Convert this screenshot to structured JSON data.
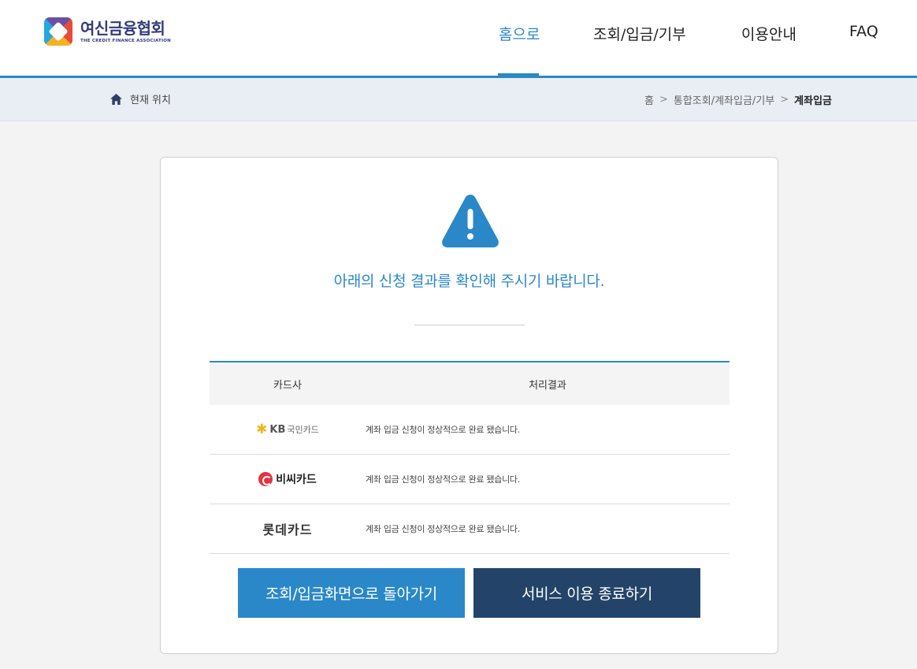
{
  "header": {
    "logo_kr": "여신금융협회",
    "logo_en": "THE CREDIT FINANCE ASSOCIATION",
    "nav": [
      {
        "label": "홈으로",
        "active": true
      },
      {
        "label": "조회/입금/기부",
        "active": false
      },
      {
        "label": "이용안내",
        "active": false
      },
      {
        "label": "FAQ",
        "active": false
      }
    ]
  },
  "breadcrumb": {
    "location_label": "현재 위치",
    "items": [
      "홈",
      "통합조회/계좌입금/기부",
      "계좌입금"
    ]
  },
  "result": {
    "message": "아래의 신청 결과를 확인해 주시기 바랍니다.",
    "table_headers": {
      "card": "카드사",
      "result": "처리결과"
    },
    "rows": [
      {
        "card": "KB국민카드",
        "card_brand": "KB",
        "card_suffix": "국민카드",
        "result": "계좌 입금 신청이 정상적으로 완료 됐습니다."
      },
      {
        "card": "비씨카드",
        "result": "계좌 입금 신청이 정상적으로 완료 됐습니다."
      },
      {
        "card": "롯데카드",
        "result": "계좌 입금 신청이 정상적으로 완료 됐습니다."
      }
    ]
  },
  "buttons": {
    "back": "조회/입금화면으로 돌아가기",
    "exit": "서비스 이용 종료하기"
  },
  "colors": {
    "accent": "#2a88c8",
    "dark_button": "#234468"
  }
}
